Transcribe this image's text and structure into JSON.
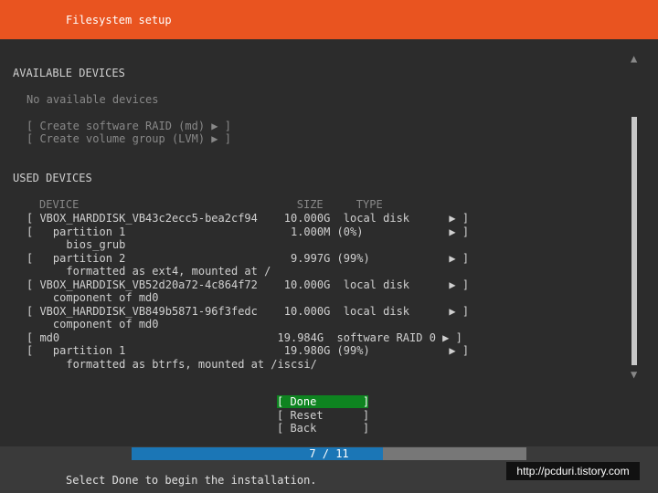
{
  "header": {
    "title": "Filesystem setup"
  },
  "available": {
    "heading": "AVAILABLE DEVICES",
    "empty_text": "No available devices",
    "actions": [
      "[ Create software RAID (md) ▶ ]",
      "[ Create volume group (LVM) ▶ ]"
    ]
  },
  "used": {
    "heading": "USED DEVICES",
    "column_header": "DEVICE                                 SIZE     TYPE",
    "rows": [
      "[ VBOX_HARDDISK_VB43c2ecc5-bea2cf94    10.000G  local disk      ▶ ]",
      "[   partition 1                         1.000M (0%)             ▶ ]",
      "      bios_grub",
      "[   partition 2                         9.997G (99%)            ▶ ]",
      "      formatted as ext4, mounted at /",
      "[ VBOX_HARDDISK_VB52d20a72-4c864f72    10.000G  local disk      ▶ ]",
      "    component of md0",
      "[ VBOX_HARDDISK_VB849b5871-96f3fedc    10.000G  local disk      ▶ ]",
      "    component of md0",
      "[ md0                                 19.984G  software RAID 0 ▶ ]",
      "[   partition 1                        19.980G (99%)            ▶ ]",
      "      formatted as btrfs, mounted at /iscsi/"
    ]
  },
  "buttons": {
    "done": "[ Done       ]",
    "reset": "[ Reset      ]",
    "back": "[ Back       ]"
  },
  "scroll": {
    "up_icon": "▲",
    "down_icon": "▼"
  },
  "progress": {
    "text": "7 / 11",
    "fraction": 0.6364
  },
  "footer": {
    "hint": "Select Done to begin the installation."
  },
  "watermark": {
    "text": "http://pcduri.tistory.com"
  },
  "colors": {
    "header": "#e95420",
    "done_button": "#0e8420",
    "progress_fill": "#1b76b6"
  }
}
